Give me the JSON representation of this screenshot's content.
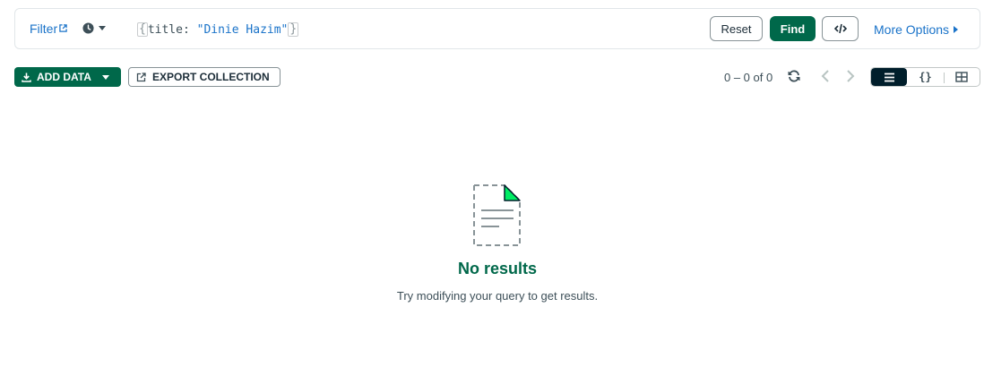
{
  "query_bar": {
    "filter_label": "Filter",
    "query_key": "title:",
    "query_value": "\"Dinie Hazim\"",
    "reset_label": "Reset",
    "find_label": "Find",
    "more_options_label": "More Options"
  },
  "toolbar": {
    "add_data_label": "ADD DATA",
    "export_label": "EXPORT COLLECTION",
    "pagination_text": "0 – 0 of 0"
  },
  "empty_state": {
    "title": "No results",
    "subtitle": "Try modifying your query to get results."
  },
  "colors": {
    "brand_green": "#00684a",
    "link_blue": "#1a73c9",
    "dark": "#001e2b"
  }
}
